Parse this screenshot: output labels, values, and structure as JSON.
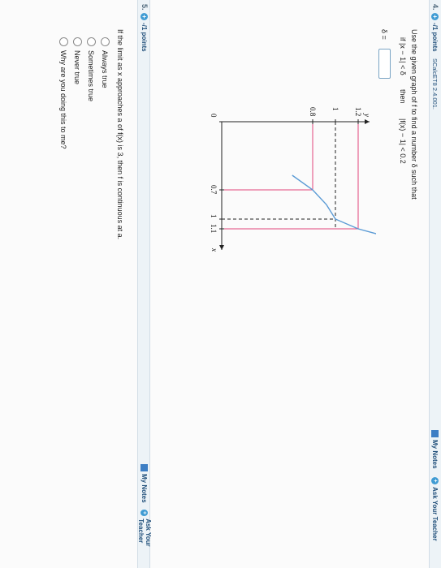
{
  "question4": {
    "number": "4.",
    "points": "-/1 points",
    "source": "SCalcET8 2.4.001.",
    "my_notes": "My Notes",
    "ask_teacher": "Ask Your Teacher",
    "prompt": "Use the given graph of f to find a number δ such that",
    "condition_if": "if |x − 1| < δ",
    "condition_then": "then",
    "condition_result": "|f(x) − 1| < 0.2",
    "delta_label": "δ =",
    "delta_value": ""
  },
  "question5": {
    "number": "5.",
    "points": "-/1 points",
    "my_notes": "My Notes",
    "ask_teacher": "Ask Your Teacher",
    "prompt": "If the limit as x approaches a of f(x) is 3, then f is continuous at a.",
    "options": [
      "Always true",
      "Sometimes true",
      "Never true",
      "Why are you doing this to me?"
    ]
  },
  "chart_data": {
    "type": "line",
    "title": "",
    "xlabel": "x",
    "ylabel": "y",
    "x_ticks": [
      "0",
      "0.7",
      "1",
      "1.1"
    ],
    "y_ticks": [
      "1.2",
      "1",
      "0.8"
    ],
    "series": [
      {
        "x": [
          0.55,
          0.7,
          0.85,
          1.0,
          1.1,
          1.18
        ],
        "y": [
          0.62,
          0.8,
          0.92,
          1.0,
          1.2,
          1.45
        ]
      }
    ],
    "guides": [
      {
        "kind": "horizontal",
        "y": 1.2
      },
      {
        "kind": "horizontal",
        "y": 1.0
      },
      {
        "kind": "horizontal",
        "y": 0.8
      },
      {
        "kind": "vertical",
        "x": 0.7
      },
      {
        "kind": "vertical",
        "x": 1.0
      },
      {
        "kind": "vertical",
        "x": 1.1
      }
    ],
    "colors": {
      "curve": "#5b9bd5",
      "guide_pink": "#e0457b",
      "guide_dark": "#222222"
    }
  }
}
